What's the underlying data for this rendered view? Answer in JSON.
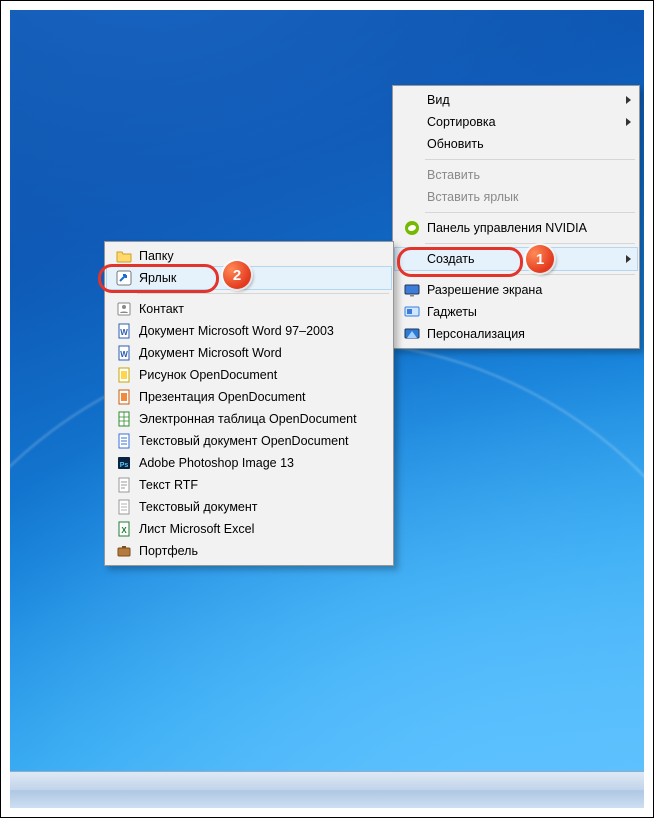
{
  "primary_menu": {
    "view": "Вид",
    "sort": "Сортировка",
    "refresh": "Обновить",
    "paste": "Вставить",
    "paste_shortcut": "Вставить ярлык",
    "nvidia": "Панель управления NVIDIA",
    "create": "Создать",
    "screen_res": "Разрешение экрана",
    "gadgets": "Гаджеты",
    "personalization": "Персонализация"
  },
  "sub_menu": {
    "folder": "Папку",
    "shortcut": "Ярлык",
    "contact": "Контакт",
    "word97": "Документ Microsoft Word 97–2003",
    "word": "Документ Microsoft Word",
    "od_draw": "Рисунок OpenDocument",
    "od_pres": "Презентация OpenDocument",
    "od_sheet": "Электронная таблица OpenDocument",
    "od_text": "Текстовый документ OpenDocument",
    "psd": "Adobe Photoshop Image 13",
    "rtf": "Текст RTF",
    "txt": "Текстовый документ",
    "xls": "Лист Microsoft Excel",
    "briefcase": "Портфель"
  },
  "annotations": {
    "badge1": "1",
    "badge2": "2"
  }
}
